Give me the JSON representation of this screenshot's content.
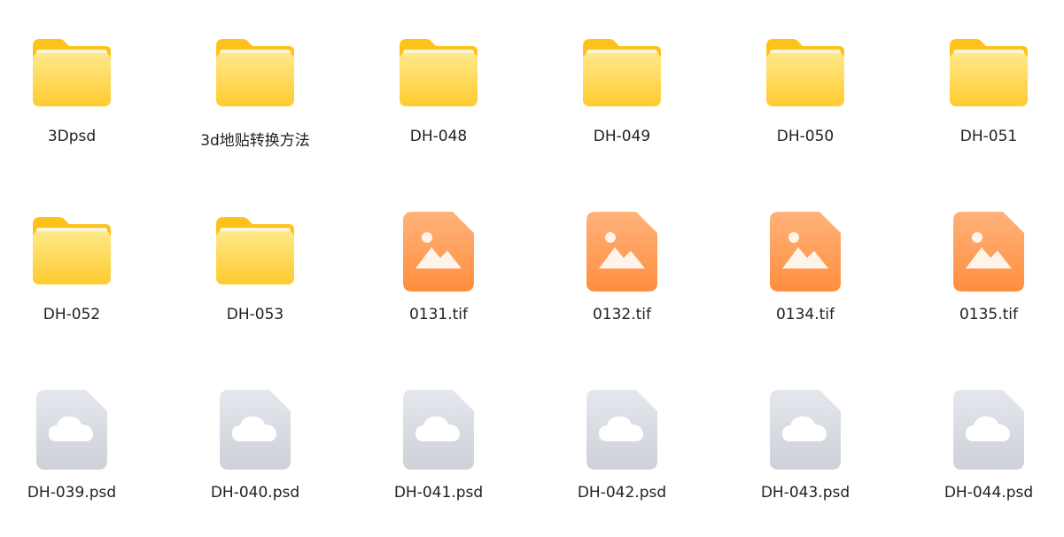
{
  "items": [
    {
      "name": "3Dpsd",
      "kind": "folder",
      "icon": "folder-icon"
    },
    {
      "name": "3d地贴转换方法",
      "kind": "folder",
      "icon": "folder-icon"
    },
    {
      "name": "DH-048",
      "kind": "folder",
      "icon": "folder-icon"
    },
    {
      "name": "DH-049",
      "kind": "folder",
      "icon": "folder-icon"
    },
    {
      "name": "DH-050",
      "kind": "folder",
      "icon": "folder-icon"
    },
    {
      "name": "DH-051",
      "kind": "folder",
      "icon": "folder-icon"
    },
    {
      "name": "DH-052",
      "kind": "folder",
      "icon": "folder-icon"
    },
    {
      "name": "DH-053",
      "kind": "folder",
      "icon": "folder-icon"
    },
    {
      "name": "0131.tif",
      "kind": "image",
      "icon": "image-file-icon"
    },
    {
      "name": "0132.tif",
      "kind": "image",
      "icon": "image-file-icon"
    },
    {
      "name": "0134.tif",
      "kind": "image",
      "icon": "image-file-icon"
    },
    {
      "name": "0135.tif",
      "kind": "image",
      "icon": "image-file-icon"
    },
    {
      "name": "DH-039.psd",
      "kind": "cloud",
      "icon": "cloud-file-icon"
    },
    {
      "name": "DH-040.psd",
      "kind": "cloud",
      "icon": "cloud-file-icon"
    },
    {
      "name": "DH-041.psd",
      "kind": "cloud",
      "icon": "cloud-file-icon"
    },
    {
      "name": "DH-042.psd",
      "kind": "cloud",
      "icon": "cloud-file-icon"
    },
    {
      "name": "DH-043.psd",
      "kind": "cloud",
      "icon": "cloud-file-icon"
    },
    {
      "name": "DH-044.psd",
      "kind": "cloud",
      "icon": "cloud-file-icon"
    }
  ],
  "colors": {
    "folder_back": "#FFC21A",
    "folder_front_top": "#FFE88A",
    "folder_front_bottom": "#FFCB2E",
    "image_top": "#FFB27A",
    "image_bottom": "#FF8E3E",
    "cloud_file_top": "#E4E7EC",
    "cloud_file_bottom": "#CDD1D8",
    "label_text": "#222222"
  }
}
